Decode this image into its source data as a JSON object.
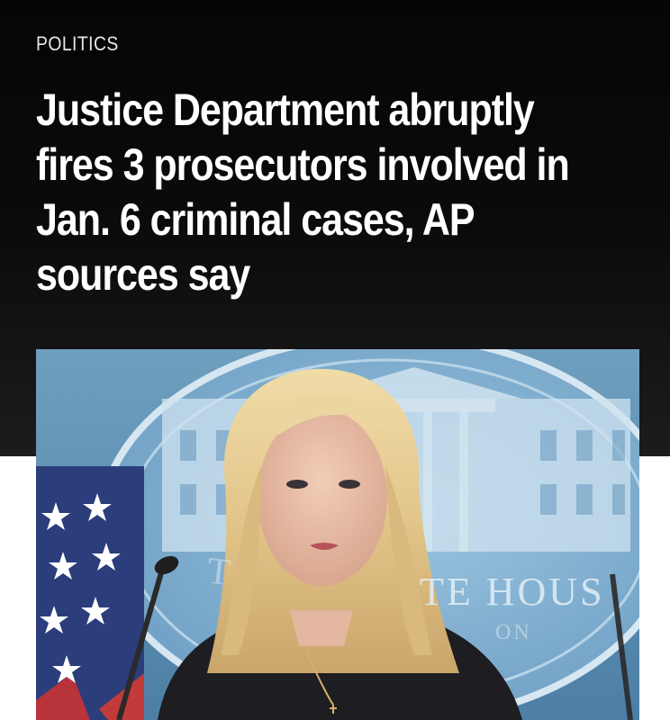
{
  "article": {
    "section": "POLITICS",
    "headline": "Justice Department abruptly fires 3 prosecutors involved in Jan. 6 criminal cases, AP sources say"
  },
  "photo": {
    "description_icon": "press-briefing-photo",
    "backdrop_text_left": "T",
    "backdrop_text_right": "TE HOUS",
    "backdrop_text_small": "ON"
  },
  "colors": {
    "hero_background": "#050505",
    "headline_text": "#ffffff",
    "section_text": "#e6e6e6",
    "page_background": "#ffffff"
  }
}
